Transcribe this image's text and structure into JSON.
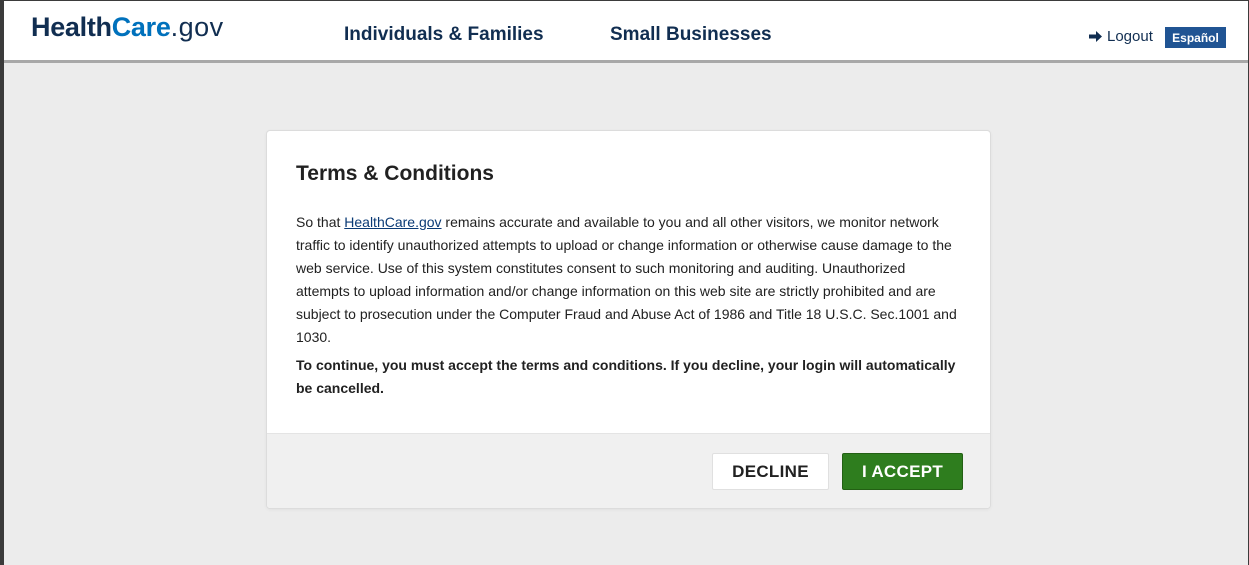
{
  "header": {
    "logo": {
      "part1": "Health",
      "part2": "Care",
      "part3": ".gov"
    },
    "nav": {
      "individuals": "Individuals & Families",
      "small_business": "Small Businesses"
    },
    "logout_label": "Logout",
    "espanol_label": "Español"
  },
  "modal": {
    "title": "Terms & Conditions",
    "body_prefix": "So that ",
    "body_link": "HealthCare.gov",
    "body_suffix": " remains accurate and available to you and all other visitors, we monitor network traffic to identify unauthorized attempts to upload or change information or otherwise cause damage to the web service. Use of this system constitutes consent to such monitoring and auditing. Unauthorized attempts to upload information and/or change information on this web site are strictly prohibited and are subject to prosecution under the Computer Fraud and Abuse Act of 1986 and Title 18 U.S.C. Sec.1001 and 1030.",
    "warning": "To continue, you must accept the terms and conditions. If you decline, your login will automatically be cancelled.",
    "decline_label": "DECLINE",
    "accept_label": "I ACCEPT"
  },
  "colors": {
    "brand_navy": "#112e51",
    "brand_blue": "#0071bc",
    "espanol_bg": "#205493",
    "accept_green": "#2e7d1e",
    "page_bg": "#ececec"
  },
  "icons": {
    "logout": "arrow-right-icon"
  }
}
